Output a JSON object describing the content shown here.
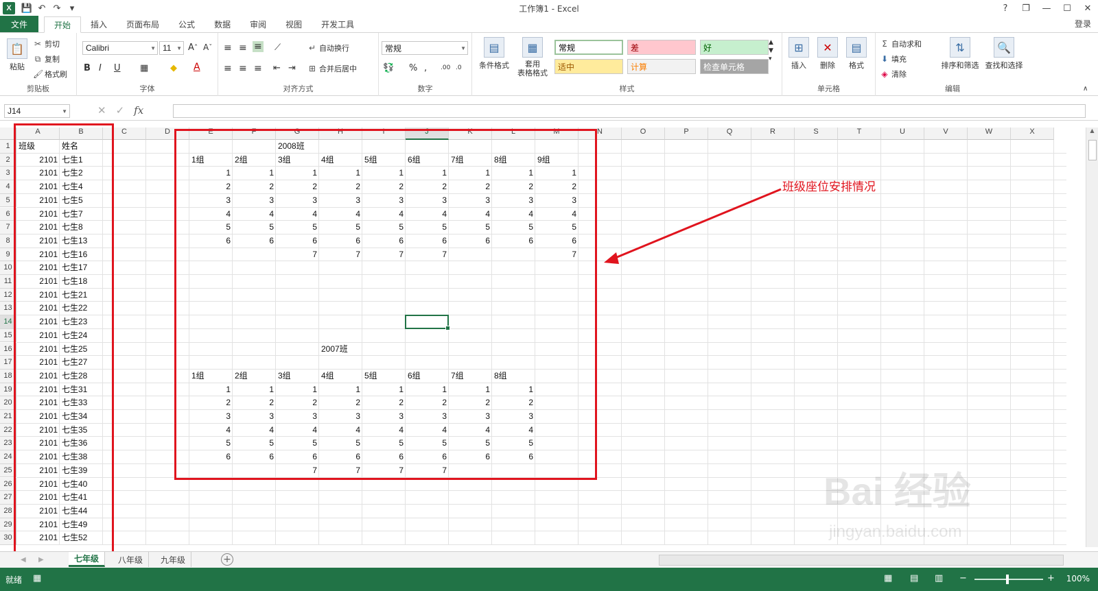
{
  "window": {
    "title": "工作簿1 - Excel",
    "help": "?",
    "restore": "❐",
    "minimize": "—",
    "maximize": "☐",
    "close": "✕",
    "login": "登录"
  },
  "qat": {
    "logo": "X",
    "save": "💾",
    "undo": "↶",
    "redo": "↷",
    "more": "▾"
  },
  "tabs": [
    "文件",
    "开始",
    "插入",
    "页面布局",
    "公式",
    "数据",
    "审阅",
    "视图",
    "开发工具"
  ],
  "ribbon": {
    "clipboard": {
      "label": "剪贴板",
      "paste": "粘贴",
      "cut": "剪切",
      "copy": "复制",
      "format_painter": "格式刷"
    },
    "font": {
      "label": "字体",
      "name": "Calibri",
      "size": "11"
    },
    "alignment": {
      "label": "对齐方式",
      "wrap": "自动换行",
      "merge": "合并后居中"
    },
    "number": {
      "label": "数字",
      "format": "常规"
    },
    "styles": {
      "label": "样式",
      "cond_format": "条件格式",
      "table_format": "套用\n表格格式",
      "cells": [
        {
          "text": "常规",
          "bg": "#ffffff",
          "fg": "#000000"
        },
        {
          "text": "差",
          "bg": "#ffc7ce",
          "fg": "#9c0006"
        },
        {
          "text": "好",
          "bg": "#c6efce",
          "fg": "#006100"
        },
        {
          "text": "适中",
          "bg": "#ffeb9c",
          "fg": "#9c5700"
        },
        {
          "text": "计算",
          "bg": "#f2f2f2",
          "fg": "#fa7d00"
        },
        {
          "text": "检查单元格",
          "bg": "#a5a5a5",
          "fg": "#ffffff"
        }
      ]
    },
    "cells_group": {
      "label": "单元格",
      "insert": "插入",
      "delete": "删除",
      "format": "格式"
    },
    "editing": {
      "label": "编辑",
      "autosum": "自动求和",
      "fill": "填充",
      "clear": "清除",
      "sort": "排序和筛选",
      "find": "查找和选择"
    }
  },
  "formula_bar": {
    "namebox": "J14",
    "fx": "fx",
    "value": ""
  },
  "columns": [
    "A",
    "B",
    "C",
    "D",
    "E",
    "F",
    "G",
    "H",
    "I",
    "J",
    "K",
    "L",
    "M",
    "N",
    "O",
    "P",
    "Q",
    "R",
    "S",
    "T",
    "U",
    "V",
    "W",
    "X"
  ],
  "rows": [
    "1",
    "2",
    "3",
    "4",
    "5",
    "6",
    "7",
    "8",
    "9",
    "10",
    "11",
    "12",
    "13",
    "14",
    "15",
    "16",
    "17",
    "18",
    "19",
    "20",
    "21",
    "22",
    "23",
    "24",
    "25",
    "26",
    "27",
    "28",
    "29",
    "30"
  ],
  "sheet": {
    "headerA": "班级",
    "headerB": "姓名",
    "class_code": "2101",
    "names": [
      "七生1",
      "七生2",
      "七生4",
      "七生5",
      "七生7",
      "七生8",
      "七生13",
      "七生16",
      "七生17",
      "七生18",
      "七生21",
      "七生22",
      "七生23",
      "七生24",
      "七生25",
      "七生27",
      "七生28",
      "七生31",
      "七生33",
      "七生34",
      "七生35",
      "七生36",
      "七生38",
      "七生39",
      "七生40",
      "七生41",
      "七生44",
      "七生49",
      "七生52"
    ],
    "title2008": "2008班",
    "groups2008": [
      "1组",
      "2组",
      "3组",
      "4组",
      "5组",
      "6组",
      "7组",
      "8组",
      "9组"
    ],
    "seats2008": [
      [
        1,
        1,
        1,
        1,
        1,
        1,
        1,
        1,
        1
      ],
      [
        2,
        2,
        2,
        2,
        2,
        2,
        2,
        2,
        2
      ],
      [
        3,
        3,
        3,
        3,
        3,
        3,
        3,
        3,
        3
      ],
      [
        4,
        4,
        4,
        4,
        4,
        4,
        4,
        4,
        4
      ],
      [
        5,
        5,
        5,
        5,
        5,
        5,
        5,
        5,
        5
      ],
      [
        6,
        6,
        6,
        6,
        6,
        6,
        6,
        6,
        6
      ],
      [
        null,
        null,
        7,
        7,
        7,
        7,
        null,
        null,
        7
      ]
    ],
    "title2007": "2007班",
    "groups2007": [
      "1组",
      "2组",
      "3组",
      "4组",
      "5组",
      "6组",
      "7组",
      "8组"
    ],
    "seats2007": [
      [
        1,
        1,
        1,
        1,
        1,
        1,
        1,
        1
      ],
      [
        2,
        2,
        2,
        2,
        2,
        2,
        2,
        2
      ],
      [
        3,
        3,
        3,
        3,
        3,
        3,
        3,
        3
      ],
      [
        4,
        4,
        4,
        4,
        4,
        4,
        4,
        4
      ],
      [
        5,
        5,
        5,
        5,
        5,
        5,
        5,
        5
      ],
      [
        6,
        6,
        6,
        6,
        6,
        6,
        6,
        6
      ],
      [
        null,
        null,
        7,
        7,
        7,
        7,
        null,
        null
      ]
    ]
  },
  "annotation": "班级座位安排情况",
  "sheet_tabs": [
    "七年级",
    "八年级",
    "九年级"
  ],
  "status": {
    "ready": "就绪",
    "zoom": "100%"
  },
  "watermark": {
    "main": "Bai 经验",
    "sub": "jingyan.baidu.com"
  }
}
